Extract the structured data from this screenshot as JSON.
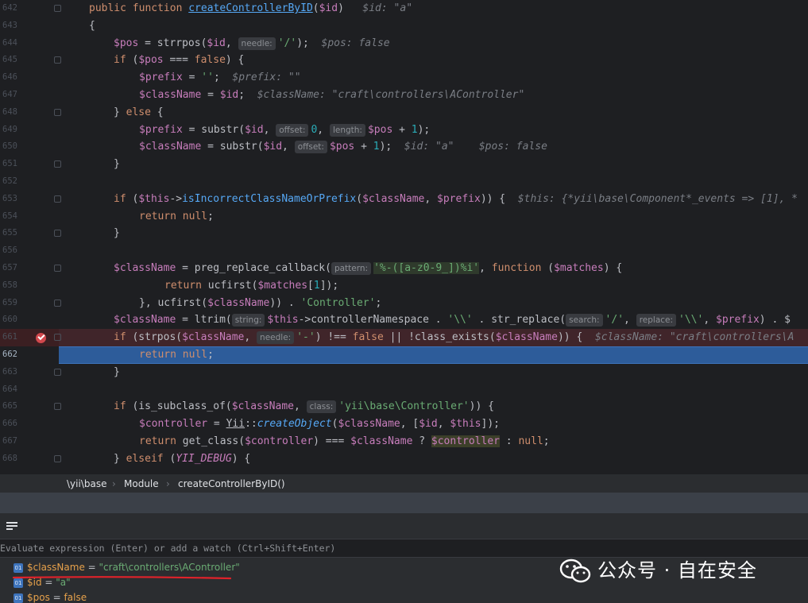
{
  "editor": {
    "lines": [
      {
        "n": "642"
      },
      {
        "n": "643"
      },
      {
        "n": "644"
      },
      {
        "n": "645"
      },
      {
        "n": "646"
      },
      {
        "n": "647"
      },
      {
        "n": "648"
      },
      {
        "n": "649"
      },
      {
        "n": "650"
      },
      {
        "n": "651"
      },
      {
        "n": "652"
      },
      {
        "n": "653"
      },
      {
        "n": "654"
      },
      {
        "n": "655"
      },
      {
        "n": "656"
      },
      {
        "n": "657"
      },
      {
        "n": "658"
      },
      {
        "n": "659"
      },
      {
        "n": "660"
      },
      {
        "n": "661"
      },
      {
        "n": "662"
      },
      {
        "n": "663"
      },
      {
        "n": "664"
      },
      {
        "n": "665"
      },
      {
        "n": "666"
      },
      {
        "n": "667"
      },
      {
        "n": "668"
      }
    ],
    "code": {
      "l642": {
        "kw1": "public function ",
        "fn": "createControllerByID",
        "p1": "(",
        "v1": "$id",
        "p2": ")",
        "hint": "$id: \"a\""
      },
      "l643": {
        "t": "{"
      },
      "l644": {
        "v1": "$pos",
        "t1": " = strrpos(",
        "v2": "$id",
        "t2": ", ",
        "h1": "needle:",
        "s1": "'/'",
        "t3": ");",
        "hint": "$pos: false"
      },
      "l645": {
        "kw": "if",
        "t1": " (",
        "v1": "$pos",
        "t2": " === ",
        "kw2": "false",
        "t3": ") {"
      },
      "l646": {
        "v1": "$prefix",
        "t1": " = ",
        "s1": "''",
        "t2": ";",
        "hint": "$prefix: \"\""
      },
      "l647": {
        "v1": "$className",
        "t1": " = ",
        "v2": "$id",
        "t2": ";",
        "hint": "$className: \"craft\\controllers\\AController\""
      },
      "l648": {
        "t1": "} ",
        "kw": "else",
        "t2": " {"
      },
      "l649": {
        "v1": "$prefix",
        "t1": " = substr(",
        "v2": "$id",
        "t2": ", ",
        "h1": "offset:",
        "n1": "0",
        "t3": ", ",
        "h2": "length:",
        "v3": "$pos",
        "t4": " + ",
        "n2": "1",
        "t5": ");"
      },
      "l650": {
        "v1": "$className",
        "t1": " = substr(",
        "v2": "$id",
        "t2": ", ",
        "h1": "offset:",
        "v3": "$pos",
        "t3": " + ",
        "n1": "1",
        "t4": ");",
        "hint": "$id: \"a\"",
        "hint2": "$pos: false"
      },
      "l651": {
        "t": "}"
      },
      "l653": {
        "kw": "if",
        "t1": " (",
        "v1": "$this",
        "t2": "->",
        "fn": "isIncorrectClassNameOrPrefix",
        "t3": "(",
        "v2": "$className",
        "t4": ", ",
        "v3": "$prefix",
        "t5": ")) {",
        "hint": "$this: {*yii\\base\\Component*_events => [1], *"
      },
      "l654": {
        "kw": "return",
        "kw2": " null",
        "t": ";"
      },
      "l655": {
        "t": "}"
      },
      "l657": {
        "v1": "$className",
        "t1": " = preg_replace_callback(",
        "h1": "pattern:",
        "rx": "'%-([a-z0-9_])%i'",
        "t2": ", ",
        "kw": "function",
        "t3": " (",
        "v2": "$matches",
        "t4": ") {"
      },
      "l658": {
        "kw": "return",
        "t1": " ucfirst(",
        "v1": "$matches",
        "t2": "[",
        "n1": "1",
        "t3": "]);"
      },
      "l659": {
        "t1": "}, ucfirst(",
        "v1": "$className",
        "t2": ")) . ",
        "s1": "'Controller'",
        "t3": ";"
      },
      "l660": {
        "v1": "$className",
        "t1": " = ltrim(",
        "h1": "string:",
        "v2": "$this",
        "t2": "->controllerNamespace . ",
        "s1": "'\\\\'",
        "t3": " . str_replace(",
        "h2": "search:",
        "s2": "'/'",
        "t4": ", ",
        "h3": "replace:",
        "s3": "'\\\\'",
        "t5": ", ",
        "v3": "$prefix",
        "t6": ") . $"
      },
      "l661": {
        "kw": "if",
        "t1": " (strpos(",
        "v1": "$className",
        "t2": ", ",
        "h1": "needle:",
        "s1": "'-'",
        "t3": ") !== ",
        "kw2": "false",
        "t4": " || !class_exists(",
        "v2": "$className",
        "t5": ")) {",
        "hint": "$className: \"craft\\controllers\\A"
      },
      "l662": {
        "kw": "return",
        "kw2": " null",
        "t": ";"
      },
      "l663": {
        "t": "}"
      },
      "l665": {
        "kw": "if",
        "t1": " (is_subclass_of(",
        "v1": "$className",
        "t2": ", ",
        "h1": "class:",
        "s1": "'yii\\base\\Controller'",
        "t3": ")) {"
      },
      "l666": {
        "v1": "$controller",
        "t1": " = ",
        "cls": "Yii",
        "t2": "::",
        "it": "createObject",
        "t3": "(",
        "v2": "$className",
        "t4": ", [",
        "v3": "$id",
        "t5": ", ",
        "v4": "$this",
        "t6": "]);"
      },
      "l667": {
        "kw": "return",
        "t1": " get_class(",
        "v1": "$controller",
        "t2": ") === ",
        "v2": "$className",
        "t3": " ? ",
        "v3": "$controller",
        "t4": " : ",
        "kw2": "null",
        "t5": ";"
      },
      "l668": {
        "t1": "} ",
        "kw": "elseif",
        "t2": " (",
        "c": "YII_DEBUG",
        "t3": ") {"
      }
    }
  },
  "breadcrumb": {
    "ns": "\\yii\\base",
    "cls": "Module",
    "method": "createControllerByID()"
  },
  "evaluate": {
    "placeholder": "Evaluate expression (Enter) or add a watch (Ctrl+Shift+Enter)"
  },
  "variables": [
    {
      "icon": "01",
      "name": "$className",
      "eq": " = ",
      "value": "\"craft\\controllers\\AController\""
    },
    {
      "icon": "01",
      "name": "$id",
      "eq": " = ",
      "value": "\"a\""
    },
    {
      "icon": "01",
      "name": "$pos",
      "eq": " = ",
      "value": "false"
    }
  ],
  "watermark": {
    "text": "公众号 · 自在安全"
  },
  "colors": {
    "breakpoint": "#d1484d",
    "execution_line": "#2d5c9a",
    "error_line": "#40252a",
    "underline": "#e0222a"
  }
}
